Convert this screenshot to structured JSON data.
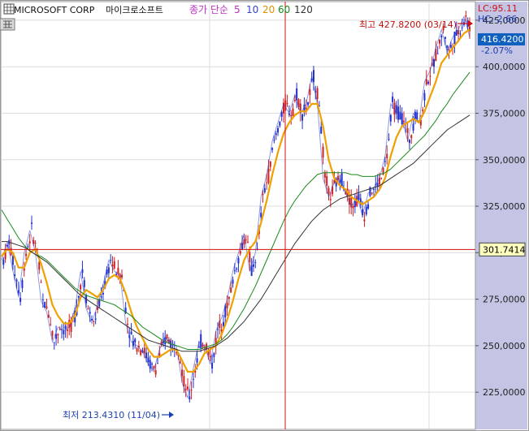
{
  "header": {
    "symbol": "MICROSOFT CORP",
    "symbol_korean": "마이크로소프트",
    "indicator_label": "종가 단순",
    "periods": [
      "5",
      "10",
      "20",
      "60",
      "120"
    ]
  },
  "readouts": {
    "lc": "LC:95.11",
    "hc": "HC:-2.66",
    "current_price": "416.4200",
    "current_change": "-2.07%",
    "crosshair_price": "301.7414",
    "high_label": "최고 427.8200 (03/14)",
    "low_label": "최저 213.4310 (11/04)"
  },
  "colors": {
    "up_candle": "#d02020",
    "down_candle": "#2030d0",
    "ma5": "#cc44cc",
    "ma10": "#3344cc",
    "ma20": "#f0a000",
    "ma60": "#1a8a1a",
    "ma120": "#333333",
    "crosshair": "#d01010",
    "price_box": "#1060c0",
    "axis_bg": "#c4c4e4"
  },
  "chart_data": {
    "type": "line",
    "title": "MICROSOFT CORP 마이크로소프트",
    "y_axis": {
      "ticks": [
        "225,0000",
        "250,0000",
        "275,0000",
        "300,0000",
        "325,0000",
        "350,0000",
        "375,0000",
        "400,0000",
        "425,0000"
      ],
      "tick_values": [
        225,
        250,
        275,
        300,
        325,
        350,
        375,
        400,
        425
      ],
      "range": [
        205,
        435
      ],
      "position": "right"
    },
    "grid": true,
    "high": {
      "value": 427.82,
      "date": "03/14"
    },
    "low": {
      "value": 213.431,
      "date": "11/04"
    },
    "crosshair_price": 301.7414,
    "last_price": 416.42,
    "series": [
      {
        "name": "5",
        "style": "candle-trend",
        "values": [
          296,
          306,
          290,
          276,
          300,
          312,
          300,
          274,
          268,
          252,
          260,
          258,
          260,
          270,
          290,
          270,
          262,
          272,
          283,
          296,
          290,
          288,
          262,
          252,
          250,
          247,
          240,
          237,
          248,
          255,
          250,
          250,
          230,
          222,
          238,
          252,
          250,
          240,
          258,
          265,
          275,
          290,
          300,
          310,
          290,
          300,
          330,
          342,
          360,
          370,
          380,
          375,
          385,
          375,
          380,
          395,
          380,
          340,
          330,
          338,
          340,
          332,
          325,
          330,
          320,
          332,
          335,
          340,
          352,
          380,
          375,
          372,
          360,
          375,
          370,
          392,
          398,
          410,
          420,
          408,
          416,
          420,
          427,
          416
        ]
      },
      {
        "name": "20",
        "values": [
          298,
          302,
          300,
          292,
          292,
          300,
          302,
          294,
          284,
          272,
          266,
          262,
          262,
          266,
          276,
          280,
          278,
          276,
          280,
          286,
          288,
          286,
          278,
          268,
          260,
          254,
          248,
          244,
          244,
          246,
          248,
          248,
          242,
          236,
          236,
          240,
          246,
          248,
          250,
          256,
          264,
          274,
          286,
          296,
          302,
          306,
          316,
          328,
          342,
          354,
          364,
          370,
          374,
          376,
          376,
          380,
          380,
          368,
          350,
          340,
          336,
          334,
          330,
          328,
          326,
          328,
          330,
          334,
          340,
          352,
          362,
          368,
          370,
          372,
          370,
          376,
          384,
          392,
          402,
          406,
          410,
          414,
          418,
          420
        ]
      },
      {
        "name": "60",
        "values": [
          323,
          318,
          313,
          308,
          304,
          301,
          299,
          298,
          296,
          293,
          290,
          287,
          284,
          281,
          279,
          277,
          276,
          275,
          274,
          273,
          272,
          270,
          268,
          266,
          263,
          260,
          258,
          256,
          254,
          252,
          251,
          250,
          249,
          248,
          248,
          248,
          249,
          250,
          251,
          253,
          256,
          260,
          265,
          270,
          276,
          282,
          289,
          296,
          303,
          310,
          317,
          323,
          328,
          332,
          336,
          339,
          342,
          343,
          343,
          343,
          343,
          343,
          342,
          342,
          341,
          341,
          341,
          342,
          343,
          345,
          348,
          351,
          354,
          357,
          360,
          363,
          367,
          371,
          376,
          380,
          385,
          389,
          393,
          397
        ]
      },
      {
        "name": "120",
        "values": [
          306,
          306,
          305,
          304,
          303,
          301,
          299,
          297,
          295,
          292,
          289,
          286,
          283,
          280,
          277,
          275,
          273,
          271,
          269,
          267,
          265,
          263,
          261,
          259,
          257,
          255,
          253,
          252,
          251,
          250,
          249,
          248,
          247,
          247,
          247,
          247,
          248,
          249,
          250,
          252,
          254,
          257,
          260,
          263,
          267,
          271,
          275,
          280,
          285,
          290,
          295,
          300,
          305,
          309,
          313,
          317,
          320,
          323,
          325,
          327,
          329,
          330,
          331,
          332,
          333,
          334,
          335,
          336,
          338,
          340,
          342,
          344,
          346,
          348,
          351,
          354,
          357,
          360,
          363,
          366,
          368,
          370,
          372,
          374
        ]
      }
    ]
  }
}
